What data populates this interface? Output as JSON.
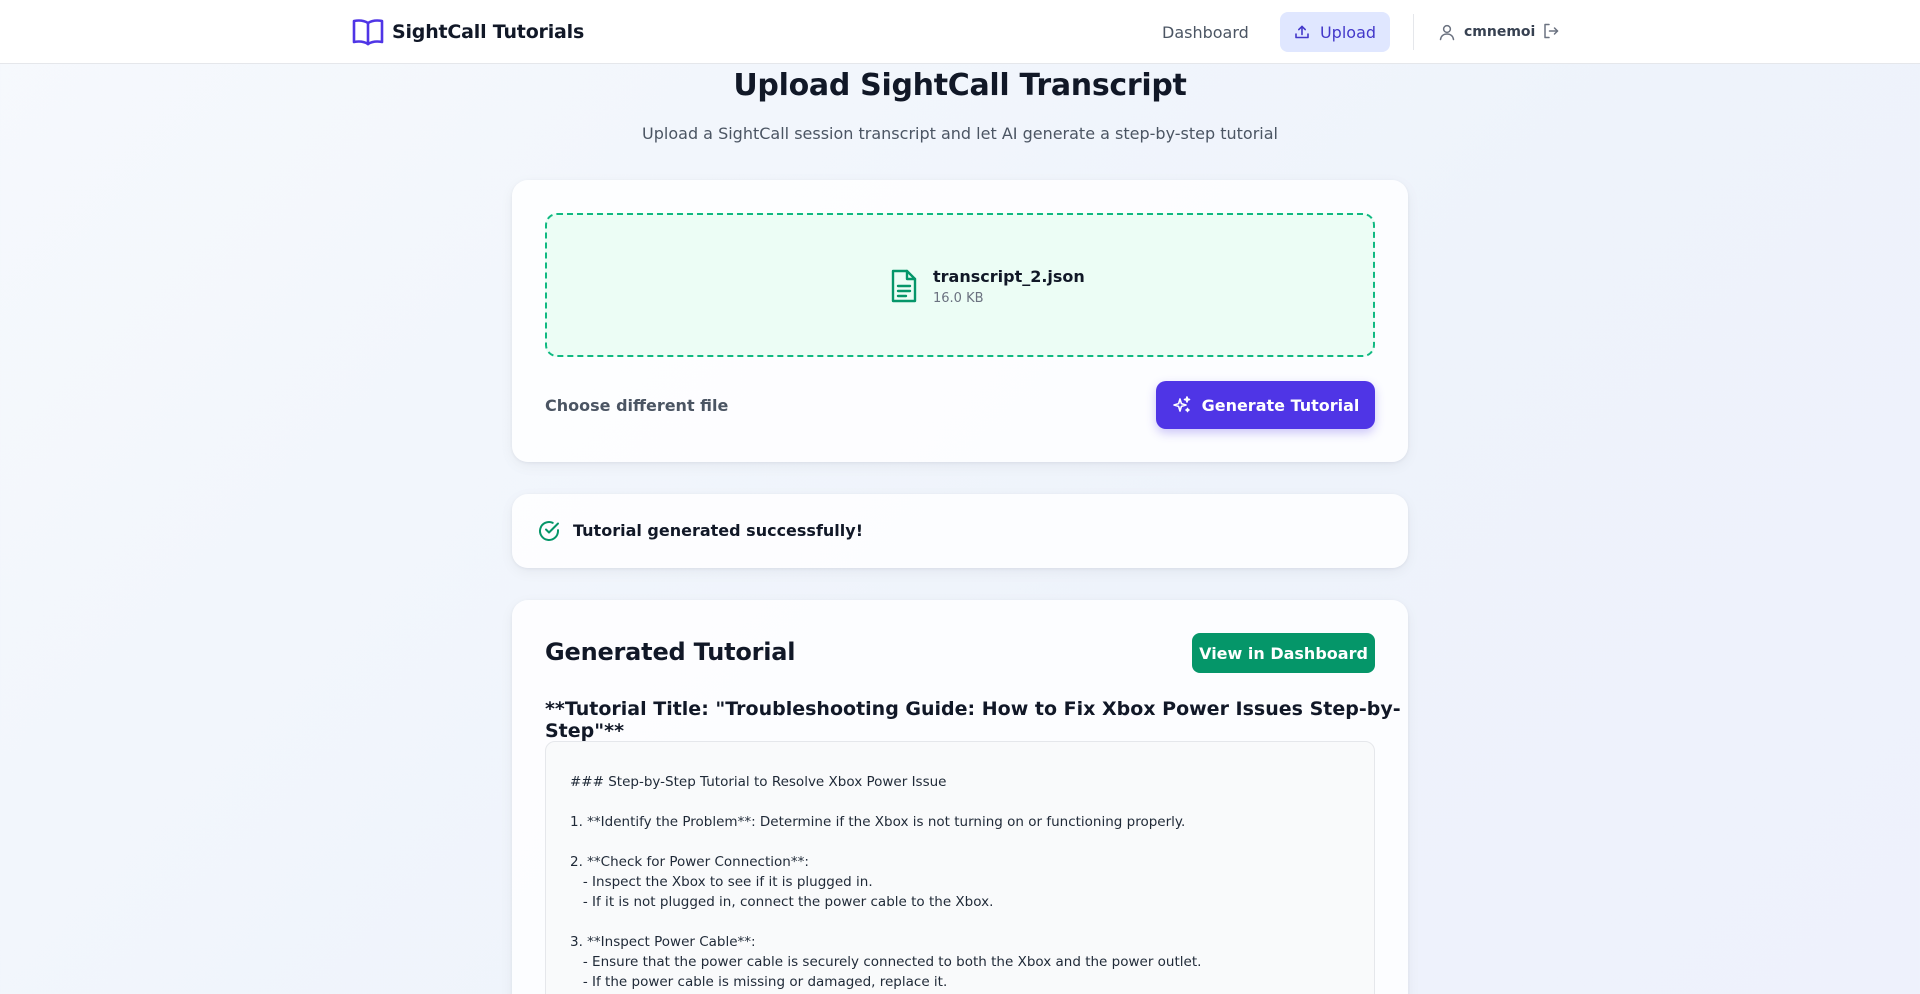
{
  "header": {
    "brand": "SightCall Tutorials",
    "nav": {
      "dashboard": "Dashboard",
      "upload": "Upload"
    },
    "user": "cmnemoi",
    "icons": {
      "brand": "book-open-icon",
      "upload": "upload-icon",
      "user": "user-icon",
      "logout": "logout-icon"
    }
  },
  "page": {
    "title": "Upload SightCall Transcript",
    "subtitle": "Upload a SightCall session transcript and let AI generate a step-by-step tutorial"
  },
  "upload": {
    "file_name": "transcript_2.json",
    "file_size": "16.0 KB",
    "choose_label": "Choose different file",
    "generate_label": "Generate Tutorial"
  },
  "status": {
    "message": "Tutorial generated successfully!"
  },
  "result": {
    "heading": "Generated Tutorial",
    "view_label": "View in Dashboard",
    "tutorial_title": "**Tutorial Title: \"Troubleshooting Guide: How to Fix Xbox Power Issues Step-by-Step\"**",
    "lines": [
      "### Step-by-Step Tutorial to Resolve Xbox Power Issue",
      "",
      "1. **Identify the Problem**: Determine if the Xbox is not turning on or functioning properly.",
      "",
      "2. **Check for Power Connection**:",
      "   - Inspect the Xbox to see if it is plugged in.",
      "   - If it is not plugged in, connect the power cable to the Xbox.",
      "",
      "3. **Inspect Power Cable**:",
      "   - Ensure that the power cable is securely connected to both the Xbox and the power outlet.",
      "   - If the power cable is missing or damaged, replace it."
    ]
  },
  "colors": {
    "accent": "#4f35e6",
    "success": "#059669",
    "dropzone_border": "#10b981",
    "dropzone_bg": "#ecfdf5",
    "nav_active_bg": "#e0e7ff"
  }
}
